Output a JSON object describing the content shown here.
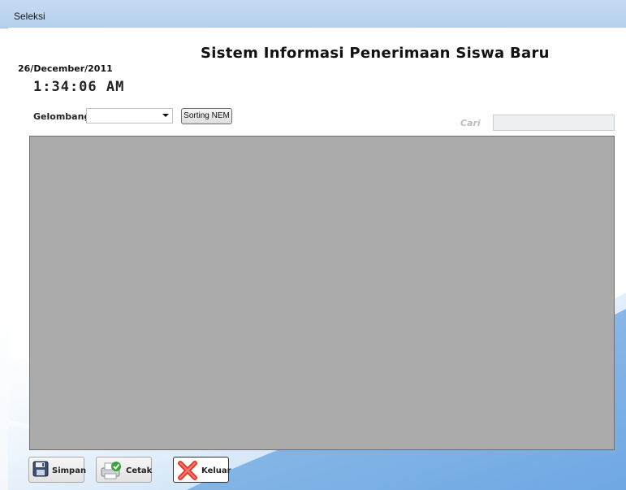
{
  "window": {
    "title": "Seleksi"
  },
  "header": {
    "title": "Sistem Informasi Penerimaan Siswa Baru",
    "date": "26/December/2011",
    "clock": "1:34:06 AM"
  },
  "filter": {
    "gelombang_label": "Gelombang",
    "gelombang_value": "",
    "sort_button": "Sorting NEM",
    "search_label": "Cari",
    "search_value": ""
  },
  "actions": {
    "simpan": "Simpan",
    "cetak": "Cetak",
    "keluar": "Keluar"
  },
  "colors": {
    "titlebar": "#c7dbf2",
    "grid_background": "#ababab",
    "accent_blue": "#4a90d9",
    "keluar_red": "#e23b2e"
  },
  "icons": {
    "simpan": "floppy-disk-icon",
    "cetak": "printer-check-icon",
    "keluar": "red-x-icon"
  }
}
